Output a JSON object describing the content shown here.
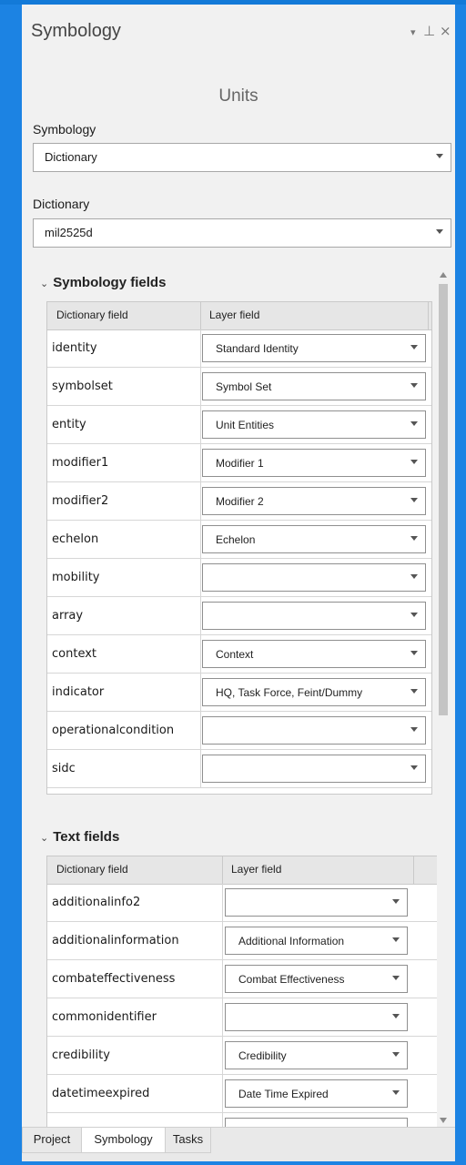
{
  "pane": {
    "title": "Symbology",
    "controls": {
      "dropdown": "▾",
      "pin": "⊥",
      "close": "×"
    },
    "layer_name": "Units"
  },
  "symbology": {
    "label": "Symbology",
    "value": "Dictionary"
  },
  "dictionary": {
    "label": "Dictionary",
    "value": "mil2525d"
  },
  "symbology_fields": {
    "title": "Symbology fields",
    "columns": [
      "Dictionary field",
      "Layer field"
    ],
    "rows": [
      {
        "field": "identity",
        "value": "Standard Identity"
      },
      {
        "field": "symbolset",
        "value": "Symbol Set"
      },
      {
        "field": "entity",
        "value": "Unit Entities"
      },
      {
        "field": "modifier1",
        "value": "Modifier 1"
      },
      {
        "field": "modifier2",
        "value": "Modifier 2"
      },
      {
        "field": "echelon",
        "value": "Echelon"
      },
      {
        "field": "mobility",
        "value": ""
      },
      {
        "field": "array",
        "value": ""
      },
      {
        "field": "context",
        "value": "Context"
      },
      {
        "field": "indicator",
        "value": "HQ, Task Force, Feint/Dummy"
      },
      {
        "field": "operationalcondition",
        "value": ""
      },
      {
        "field": "sidc",
        "value": ""
      }
    ]
  },
  "text_fields": {
    "title": "Text fields",
    "columns": [
      "Dictionary field",
      "Layer field"
    ],
    "rows": [
      {
        "field": "additionalinfo2",
        "value": ""
      },
      {
        "field": "additionalinformation",
        "value": "Additional Information"
      },
      {
        "field": "combateffectiveness",
        "value": "Combat Effectiveness"
      },
      {
        "field": "commonidentifier",
        "value": ""
      },
      {
        "field": "credibility",
        "value": "Credibility"
      },
      {
        "field": "datetimeexpired",
        "value": "Date Time Expired"
      },
      {
        "field": "",
        "value": ""
      }
    ]
  },
  "tabs": [
    "Project",
    "Symbology",
    "Tasks"
  ],
  "active_tab": "Symbology",
  "colors": {
    "background_blue": "#1c83e3",
    "pane": "#f1f1f1"
  }
}
